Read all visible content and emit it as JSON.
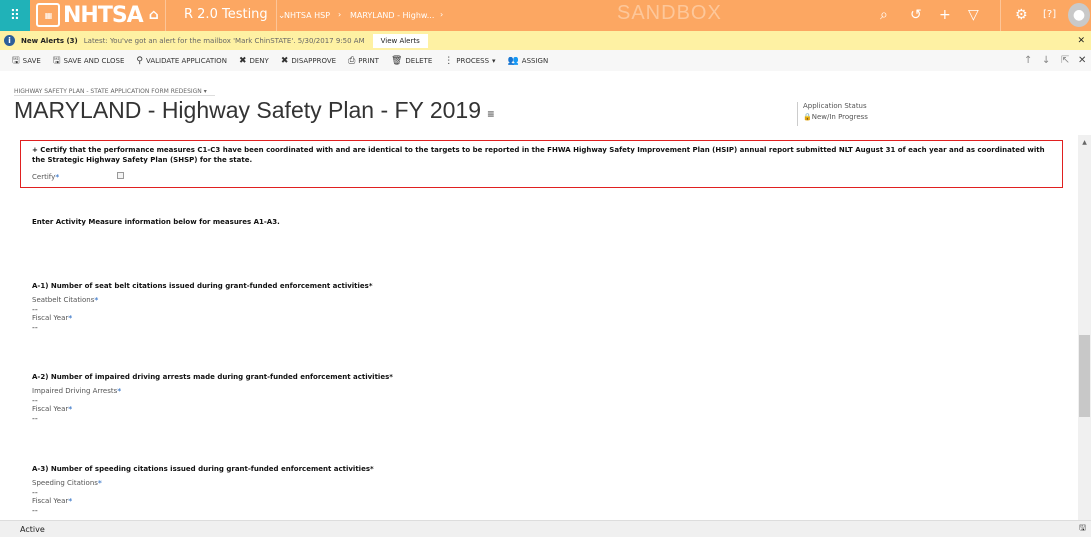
{
  "topbar": {
    "logo": "NHTSA",
    "app": "R 2.0 Testing",
    "crumb1": "NHTSA HSP",
    "crumb2": "MARYLAND - Highw...",
    "env": "SANDBOX"
  },
  "alerts": {
    "title": "New Alerts (3)",
    "message": "Latest: You've got an alert for the mailbox 'Mark ChinSTATE'. 5/30/2017 9:50 AM",
    "view": "View Alerts"
  },
  "toolbar": {
    "save": "SAVE",
    "save_close": "SAVE AND CLOSE",
    "validate": "VALIDATE APPLICATION",
    "deny": "DENY",
    "disapprove": "DISAPPROVE",
    "print": "PRINT",
    "delete": "DELETE",
    "process": "PROCESS",
    "assign": "ASSIGN"
  },
  "header": {
    "form_selector": "HIGHWAY SAFETY PLAN - STATE APPLICATION FORM REDESIGN",
    "title": "MARYLAND - Highway Safety Plan - FY 2019",
    "status_label": "Application Status",
    "status_value": "New/In Progress"
  },
  "certify": {
    "text": "+ Certify that the performance measures C1-C3 have been coordinated with and are identical to the targets to be reported in the FHWA Highway Safety Improvement Plan (HSIP) annual report submitted NLT August 31 of each year and as coordinated with the Strategic Highway Safety Plan (SHSP) for the state.",
    "label": "Certify"
  },
  "intro": "Enter Activity Measure information below for measures A1-A3.",
  "sections": [
    {
      "header": "A-1) Number of seat belt citations issued during grant-funded enforcement activities*",
      "f1": "Seatbelt Citations",
      "v1": "--",
      "f2": "Fiscal Year",
      "v2": "--"
    },
    {
      "header": "A-2) Number of impaired driving arrests made during grant-funded enforcement activities*",
      "f1": "Impaired Driving Arrests",
      "v1": "--",
      "f2": "Fiscal Year",
      "v2": "--"
    },
    {
      "header": "A-3) Number of speeding citations issued during grant-funded enforcement activities*",
      "f1": "Speeding Citations",
      "v1": "--",
      "f2": "Fiscal Year",
      "v2": "--"
    }
  ],
  "status": "Active",
  "required_mark": "*"
}
